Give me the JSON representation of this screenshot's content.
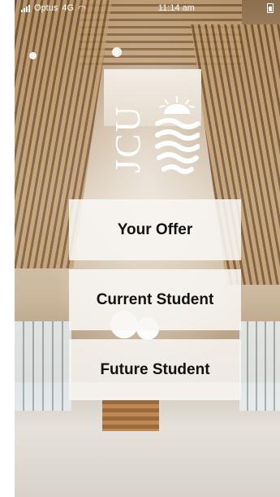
{
  "status_bar": {
    "carrier": "Optus",
    "network": "4G",
    "time": "11:14 am"
  },
  "logo": {
    "text": "JCU"
  },
  "buttons": {
    "your_offer": "Your Offer",
    "current_student": "Current Student",
    "future_student": "Future Student"
  },
  "icons": [
    "signal-icon",
    "wifi-icon",
    "battery-icon",
    "jcu-logo-mark"
  ],
  "colors": {
    "button_bg": "#f8f6f3",
    "button_text": "#111111",
    "logo": "#ffffff"
  }
}
